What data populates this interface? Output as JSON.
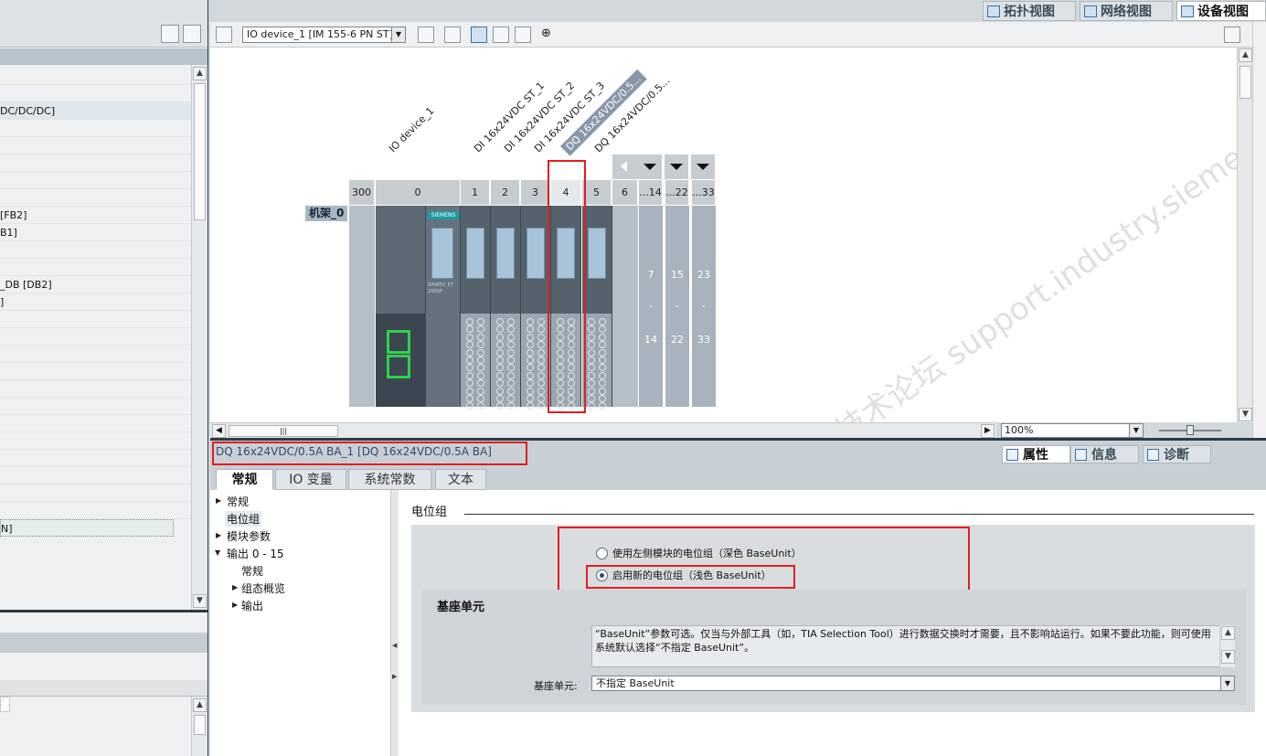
{
  "left_tree": {
    "rows": [
      {
        "text": ""
      },
      {
        "text": ""
      },
      {
        "text": "DC/DC/DC]"
      },
      {
        "text": ""
      },
      {
        "text": ""
      },
      {
        "text": ""
      },
      {
        "text": ""
      },
      {
        "text": ""
      },
      {
        "text": "[FB2]"
      },
      {
        "text": "B1]"
      },
      {
        "text": ""
      },
      {
        "text": ""
      },
      {
        "text": "_DB [DB2]"
      },
      {
        "text": "]"
      },
      {
        "text": ""
      },
      {
        "text": ""
      },
      {
        "text": ""
      },
      {
        "text": ""
      },
      {
        "text": ""
      },
      {
        "text": ""
      },
      {
        "text": ""
      },
      {
        "text": ""
      },
      {
        "text": ""
      },
      {
        "text": ""
      },
      {
        "text": ""
      },
      {
        "text": ""
      },
      {
        "text": "N]"
      }
    ]
  },
  "view_tabs": {
    "topology": "拓扑视图",
    "network": "网络视图",
    "device": "设备视图"
  },
  "toolbar": {
    "device_select": "IO device_1 [IM 155-6 PN ST]"
  },
  "canvas": {
    "module_labels": [
      "IO device_1",
      "DI 16x24VDC ST_1",
      "DI 16x24VDC ST_2",
      "DI 16x24VDC ST_3",
      "DQ 16x24VDC/0.5...",
      "DQ 16x24VDC/0.5..."
    ],
    "slots": [
      "300",
      "0",
      "1",
      "2",
      "3",
      "4",
      "5",
      "6",
      "...14",
      "...22",
      "...33"
    ],
    "rack_label": "机架_0",
    "ext_columns": [
      {
        "top": "7",
        "mid": "-",
        "bottom": "14"
      },
      {
        "top": "15",
        "mid": "-",
        "bottom": "22"
      },
      {
        "top": "23",
        "mid": "-",
        "bottom": "33"
      }
    ],
    "brand": "SIEMENS",
    "head_text": "SIMATIC ET 200SP",
    "watermark": "西门子工业 技术论坛 support.industry.siemens.com/cs",
    "zoom": "100%"
  },
  "inspector": {
    "title": "DQ 16x24VDC/0.5A BA_1 [DQ 16x24VDC/0.5A BA]",
    "tabs": {
      "properties": "属性",
      "info": "信息",
      "diagnostics": "诊断"
    },
    "sub_tabs": [
      "常规",
      "IO 变量",
      "系统常数",
      "文本"
    ],
    "nav": {
      "general": "常规",
      "potential_group": "电位组",
      "module_params": "模块参数",
      "output_range": "输出 0 - 15",
      "output_general": "常规",
      "config_overview": "组态概览",
      "output": "输出"
    },
    "section_title": "电位组",
    "radio_left": "使用左侧模块的电位组（深色 BaseUnit）",
    "radio_new": "启用新的电位组（浅色 BaseUnit）",
    "base_unit_title": "基座单元",
    "base_desc": "“BaseUnit”参数可选。仅当与外部工具（如，TIA Selection Tool）进行数据交换时才需要，且不影响站运行。如果不要此功能，则可使用系统默认选择“不指定 BaseUnit”。",
    "base_label": "基座单元:",
    "base_value": "不指定 BaseUnit"
  },
  "colors": {
    "highlight_red": "#e11e1e",
    "port_green": "#2fd14b",
    "panel_dark": "#2c3b48",
    "selected_label": "#8797a7"
  }
}
